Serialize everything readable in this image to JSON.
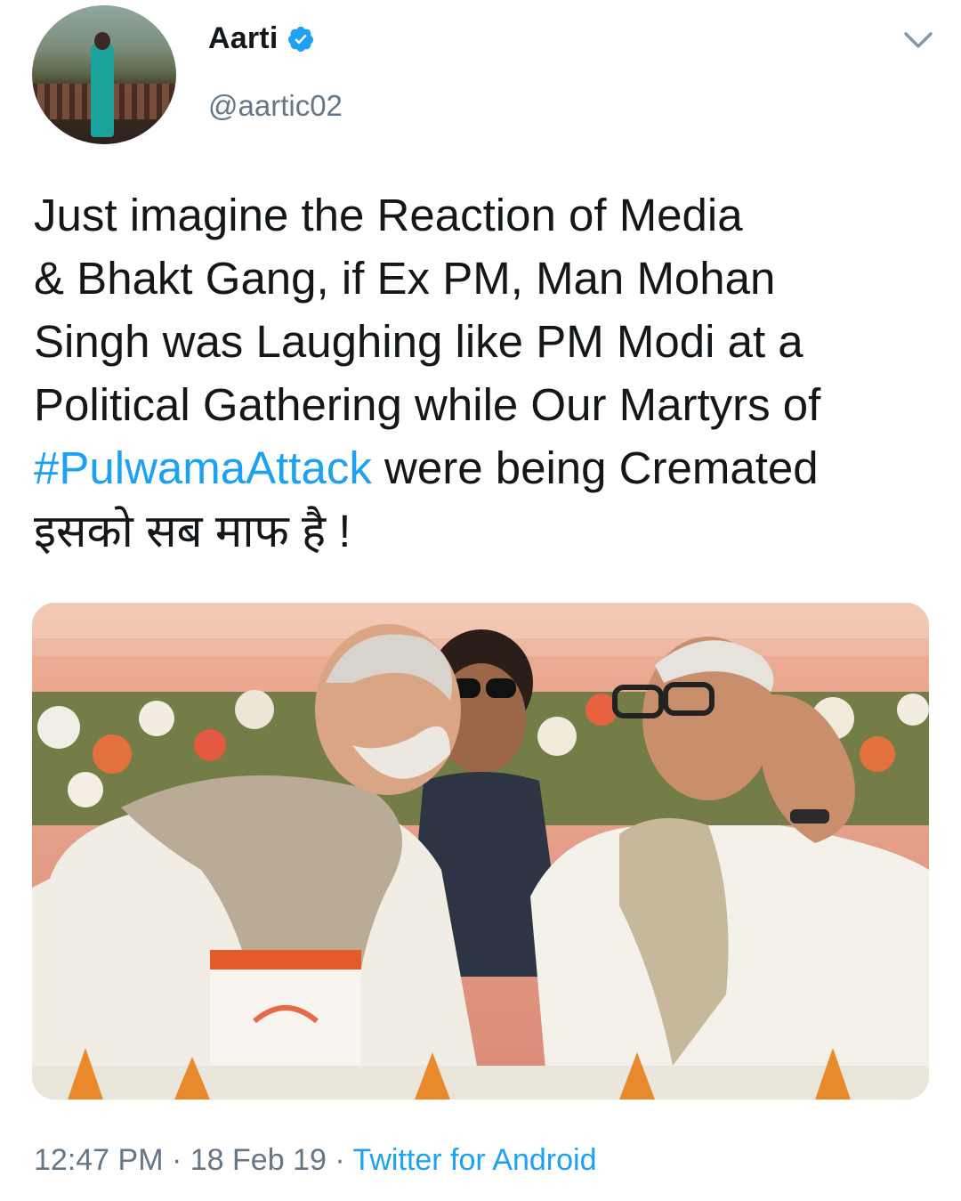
{
  "tweet": {
    "author": {
      "display_name": "Aarti",
      "handle": "@aartic02",
      "verified": true,
      "avatar_icon": "profile-photo"
    },
    "text_lines": [
      "Just imagine the Reaction of Media",
      "& Bhakt Gang, if Ex PM, Man Mohan",
      "Singh was Laughing like PM Modi at a",
      "Political Gathering while Our Martyrs of"
    ],
    "hashtag": "#PulwamaAttack",
    "text_after_hashtag": " were being Cremated",
    "hindi_line": "इसको सब माफ है !",
    "time": "12:47 PM",
    "separator": " · ",
    "date": "18 Feb 19",
    "source": "Twitter for Android",
    "menu_icon": "chevron-down-icon"
  },
  "colors": {
    "link": "#1da1f2",
    "text": "#14171a",
    "secondary": "#657786",
    "verified": "#1da1f2"
  }
}
